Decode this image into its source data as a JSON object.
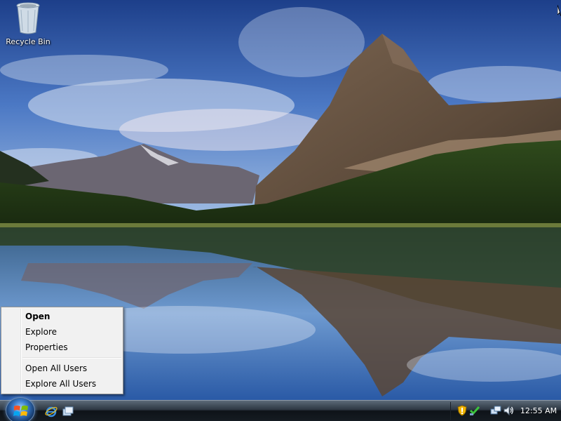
{
  "desktop": {
    "recycle_bin_label": "Recycle Bin"
  },
  "context_menu": {
    "items": [
      {
        "label": "Open",
        "bold": true
      },
      {
        "label": "Explore"
      },
      {
        "label": "Properties"
      },
      {
        "separator": true
      },
      {
        "label": "Open All Users"
      },
      {
        "label": "Explore All Users"
      }
    ]
  },
  "taskbar": {
    "start_icon": "windows-logo-icon",
    "quick_launch": [
      "internet-explorer-icon",
      "switch-windows-icon"
    ],
    "tray_icons": [
      "windows-security-shield-icon",
      "network-check-icon",
      "network-icon",
      "volume-icon"
    ],
    "clock": "12:55 AM"
  },
  "colors": {
    "taskbar_top": "#5c6a78",
    "taskbar_bottom": "#151b22",
    "menu_background": "#f1f1f1",
    "menu_border": "#979797"
  }
}
